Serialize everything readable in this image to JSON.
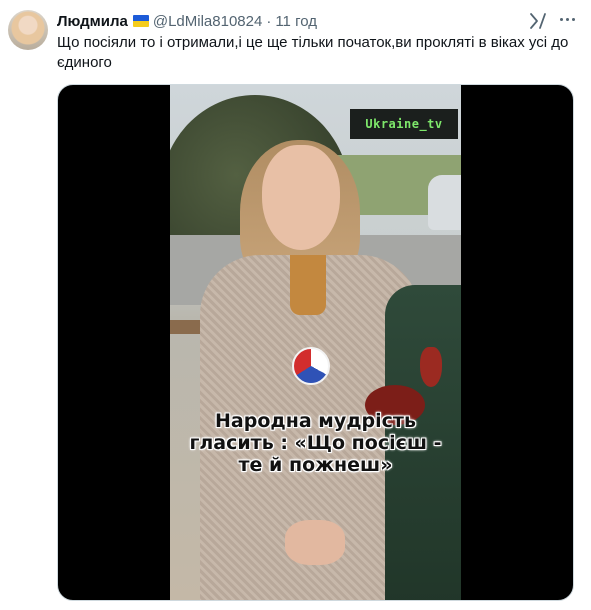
{
  "tweet": {
    "author_name": "Людмила",
    "author_handle": "@LdMila810824",
    "separator": "·",
    "time": "11 год",
    "text": "Що посіяли то і отримали,і це ще тільки початок,ви прокляті в віках усі до єдиного"
  },
  "media": {
    "watermark": "Ukraine_tv",
    "caption_lines": [
      "Народна мудрість",
      "гласить : «Що посієш -",
      "те й пожнеш»"
    ]
  },
  "icons": {
    "flag": "ukraine-flag-icon",
    "grok": "grok-icon",
    "more": "more-icon"
  },
  "colors": {
    "text_primary": "#0f1419",
    "text_secondary": "#536471",
    "watermark_text": "#7ee86b",
    "flag_blue": "#1d5bd8",
    "flag_yellow": "#f5cc1b"
  }
}
